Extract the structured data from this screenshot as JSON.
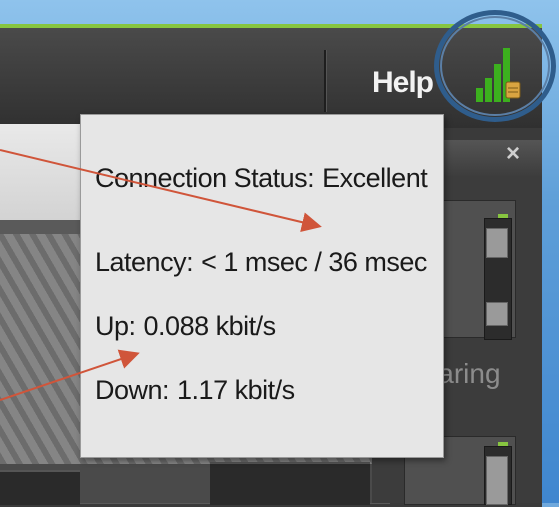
{
  "menubar": {
    "help_label": "Help"
  },
  "signal": {
    "icon": "connection-strength-icon",
    "bars_lit": 4,
    "bars_total": 4,
    "color": "#3cb01e"
  },
  "tooltip": {
    "status_label": "Connection Status:",
    "status_value": "Excellent",
    "latency_label": "Latency:",
    "latency_value": "< 1 msec / 36 msec",
    "up_label": "Up:",
    "up_value": "0.088 kbit/s",
    "down_label": "Down:",
    "down_value": "1.17 kbit/s"
  },
  "side_panel": {
    "sharing_label": "Sharing",
    "close_glyph": "×"
  },
  "colors": {
    "accent_green": "#87c540",
    "annotation_arrow": "#d0553a",
    "highlight_ring": "#2f5d8c"
  }
}
